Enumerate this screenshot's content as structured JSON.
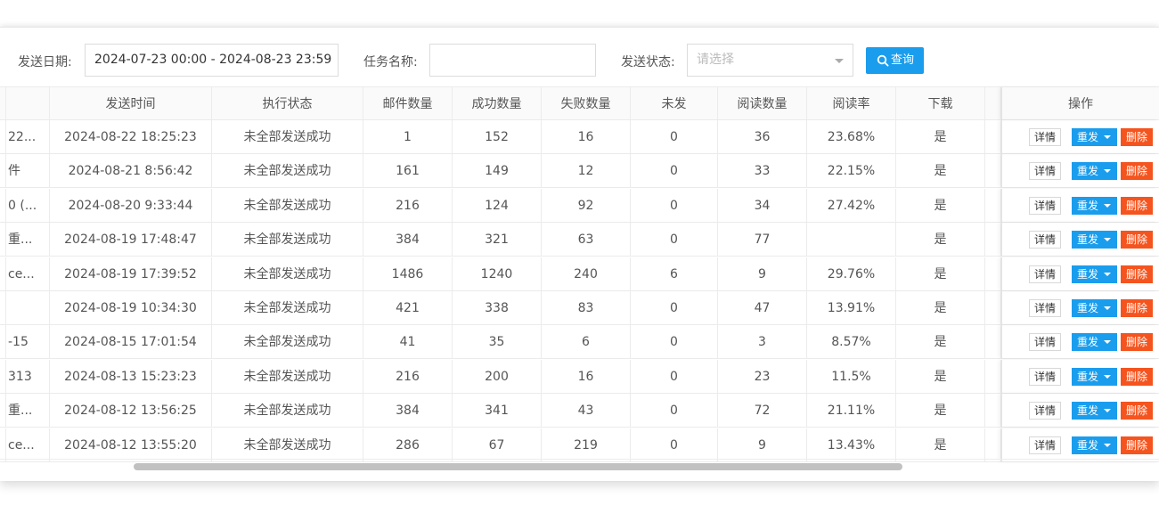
{
  "filters": {
    "date_label": "发送日期:",
    "date_value": "2024-07-23 00:00 - 2024-08-23 23:59",
    "task_label": "任务名称:",
    "task_value": "",
    "status_label": "发送状态:",
    "status_placeholder": "请选择",
    "query_label": "查询"
  },
  "table": {
    "headers": [
      "",
      "发送时间",
      "执行状态",
      "邮件数量",
      "成功数量",
      "失败数量",
      "未发",
      "阅读数量",
      "阅读率",
      "下载",
      "",
      "操作"
    ],
    "actions": {
      "detail": "详情",
      "resend": "重发",
      "delete": "删除"
    },
    "rows": [
      {
        "name": "22...",
        "time": "2024-08-22 18:25:23",
        "status": "未全部发送成功",
        "total": "1",
        "success": "152",
        "fail": "16",
        "unsent": "0",
        "read": "36",
        "rate": "23.68%",
        "download": "是"
      },
      {
        "name": "件",
        "time": "2024-08-21 8:56:42",
        "status": "未全部发送成功",
        "total": "161",
        "success": "149",
        "fail": "12",
        "unsent": "0",
        "read": "33",
        "rate": "22.15%",
        "download": "是"
      },
      {
        "name": "0 (...",
        "time": "2024-08-20 9:33:44",
        "status": "未全部发送成功",
        "total": "216",
        "success": "124",
        "fail": "92",
        "unsent": "0",
        "read": "34",
        "rate": "27.42%",
        "download": "是"
      },
      {
        "name": "重...",
        "time": "2024-08-19 17:48:47",
        "status": "未全部发送成功",
        "total": "384",
        "success": "321",
        "fail": "63",
        "unsent": "0",
        "read": "77",
        "rate": "",
        "download": "是"
      },
      {
        "name": "ce...",
        "time": "2024-08-19 17:39:52",
        "status": "未全部发送成功",
        "total": "1486",
        "success": "1240",
        "fail": "240",
        "unsent": "6",
        "read": "9",
        "rate": "29.76%",
        "download": "是"
      },
      {
        "name": "",
        "time": "2024-08-19 10:34:30",
        "status": "未全部发送成功",
        "total": "421",
        "success": "338",
        "fail": "83",
        "unsent": "0",
        "read": "47",
        "rate": "13.91%",
        "download": "是"
      },
      {
        "name": "-15",
        "time": "2024-08-15 17:01:54",
        "status": "未全部发送成功",
        "total": "41",
        "success": "35",
        "fail": "6",
        "unsent": "0",
        "read": "3",
        "rate": "8.57%",
        "download": "是"
      },
      {
        "name": "313",
        "time": "2024-08-13 15:23:23",
        "status": "未全部发送成功",
        "total": "216",
        "success": "200",
        "fail": "16",
        "unsent": "0",
        "read": "23",
        "rate": "11.5%",
        "download": "是"
      },
      {
        "name": "重...",
        "time": "2024-08-12 13:56:25",
        "status": "未全部发送成功",
        "total": "384",
        "success": "341",
        "fail": "43",
        "unsent": "0",
        "read": "72",
        "rate": "21.11%",
        "download": "是"
      },
      {
        "name": "ce...",
        "time": "2024-08-12 13:55:20",
        "status": "未全部发送成功",
        "total": "286",
        "success": "67",
        "fail": "219",
        "unsent": "0",
        "read": "9",
        "rate": "13.43%",
        "download": "是"
      }
    ]
  },
  "icons": {
    "query": "search-icon",
    "resend_caret": "caret-down-icon",
    "select_caret": "caret-down-icon"
  },
  "colors": {
    "primary": "#1a9ded",
    "danger": "#f5541e",
    "border": "#ececec"
  }
}
